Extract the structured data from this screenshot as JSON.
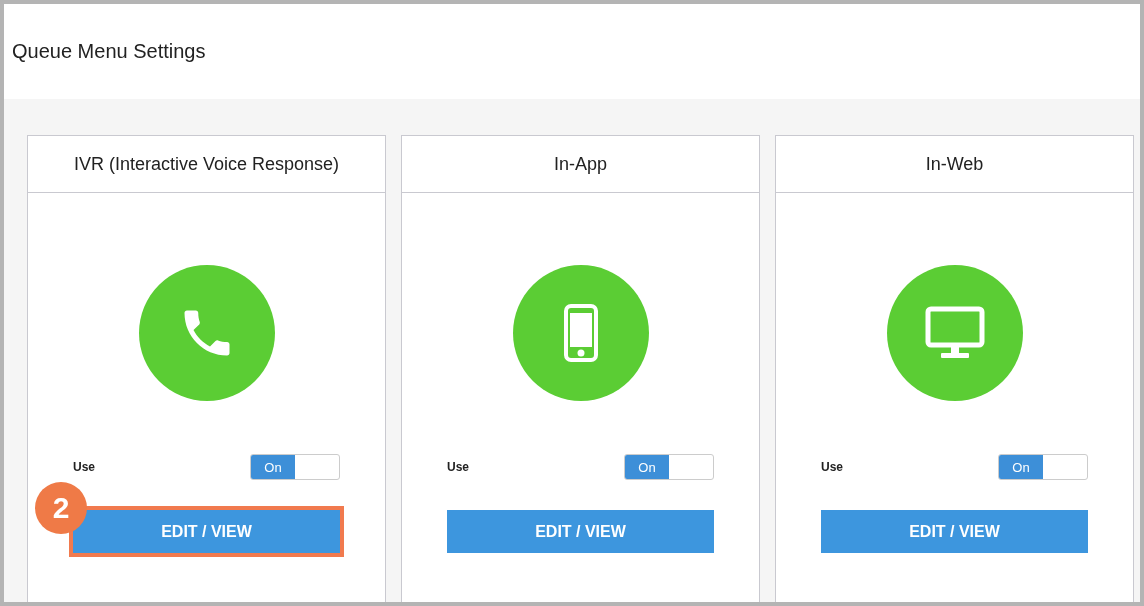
{
  "title": "Queue Menu Settings",
  "channels": [
    {
      "name": "IVR (Interactive Voice Response)",
      "kind": "phone",
      "use_label": "Use",
      "toggle": {
        "on": true,
        "label": "On"
      },
      "button": "EDIT / VIEW",
      "highlighted": true,
      "callout": "2"
    },
    {
      "name": "In-App",
      "kind": "mobile",
      "use_label": "Use",
      "toggle": {
        "on": true,
        "label": "On"
      },
      "button": "EDIT / VIEW",
      "highlighted": false
    },
    {
      "name": "In-Web",
      "kind": "monitor",
      "use_label": "Use",
      "toggle": {
        "on": true,
        "label": "On"
      },
      "button": "EDIT / VIEW",
      "highlighted": false
    }
  ]
}
